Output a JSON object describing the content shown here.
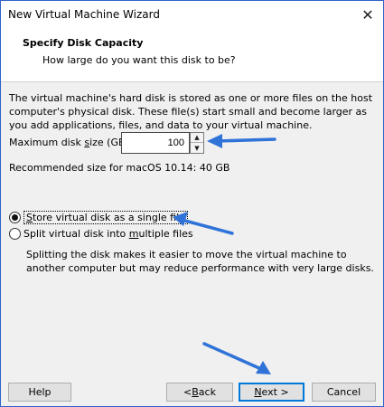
{
  "window": {
    "title": "New Virtual Machine Wizard"
  },
  "header": {
    "title": "Specify Disk Capacity",
    "subtitle": "How large do you want this disk to be?"
  },
  "description": "The virtual machine's hard disk is stored as one or more files on the host computer's physical disk. These file(s) start small and become larger as you add applications, files, and data to your virtual machine.",
  "disk_size": {
    "label_pre": "Maximum disk ",
    "label_u": "s",
    "label_post": "ize (GB):",
    "value": "100"
  },
  "recommended": "Recommended size for macOS 10.14: 40 GB",
  "options": {
    "single": {
      "pre": "",
      "u": "S",
      "post": "tore virtual disk as a single file",
      "checked": true
    },
    "multiple": {
      "pre": "Split virtual disk into ",
      "u": "m",
      "post": "ultiple files",
      "checked": false
    }
  },
  "split_description": "Splitting the disk makes it easier to move the virtual machine to another computer but may reduce performance with very large disks.",
  "buttons": {
    "help": "Help",
    "back_pre": "< ",
    "back_u": "B",
    "back_post": "ack",
    "next_u": "N",
    "next_post": "ext >",
    "cancel": "Cancel"
  },
  "colors": {
    "annotation_arrow": "#2f73d8",
    "window_border": "#2f63c9",
    "default_button": "#0078d7"
  }
}
